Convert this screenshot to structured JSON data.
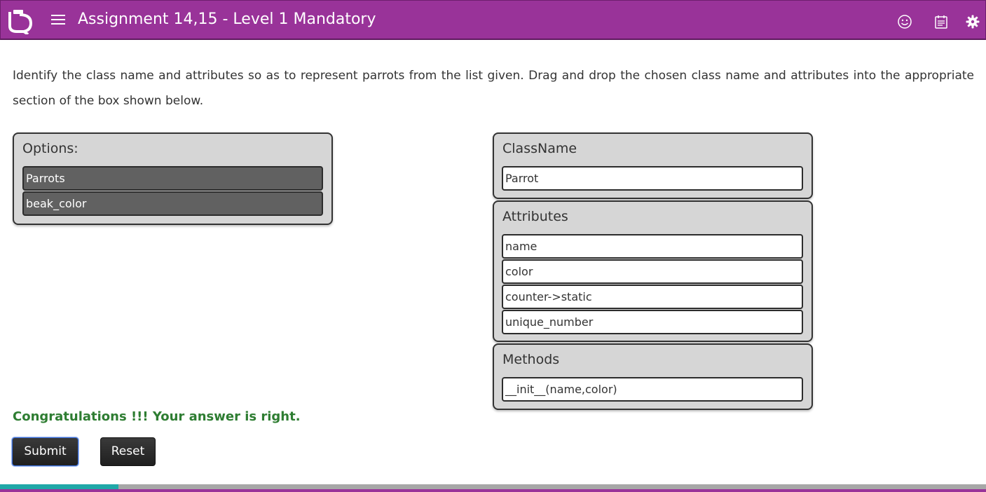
{
  "header": {
    "title": "Assignment 14,15 - Level 1 Mandatory",
    "bg_color": "#993399",
    "icons": [
      "logo-icon",
      "menu-icon",
      "smiley-icon",
      "notes-icon",
      "settings-gear-icon"
    ]
  },
  "question": {
    "text": "Identify the class name and attributes so as to represent parrots from the list given. Drag and drop the chosen class name and attributes into the appropriate section of the box shown below."
  },
  "options": {
    "title": "Options:",
    "items": [
      "Parrots",
      "beak_color"
    ]
  },
  "class_box": {
    "classname": {
      "title": "ClassName",
      "items": [
        "Parrot"
      ]
    },
    "attributes": {
      "title": "Attributes",
      "items": [
        "name",
        "color",
        "counter->static",
        "unique_number"
      ]
    },
    "methods": {
      "title": "Methods",
      "items": [
        "__init__(name,color)"
      ]
    }
  },
  "feedback": {
    "text": "Congratulations !!! Your answer is right.",
    "color": "#2e7d32"
  },
  "buttons": {
    "submit": "Submit",
    "reset": "Reset"
  },
  "progress": {
    "fraction": 0.12,
    "color": "#20a8a8"
  }
}
